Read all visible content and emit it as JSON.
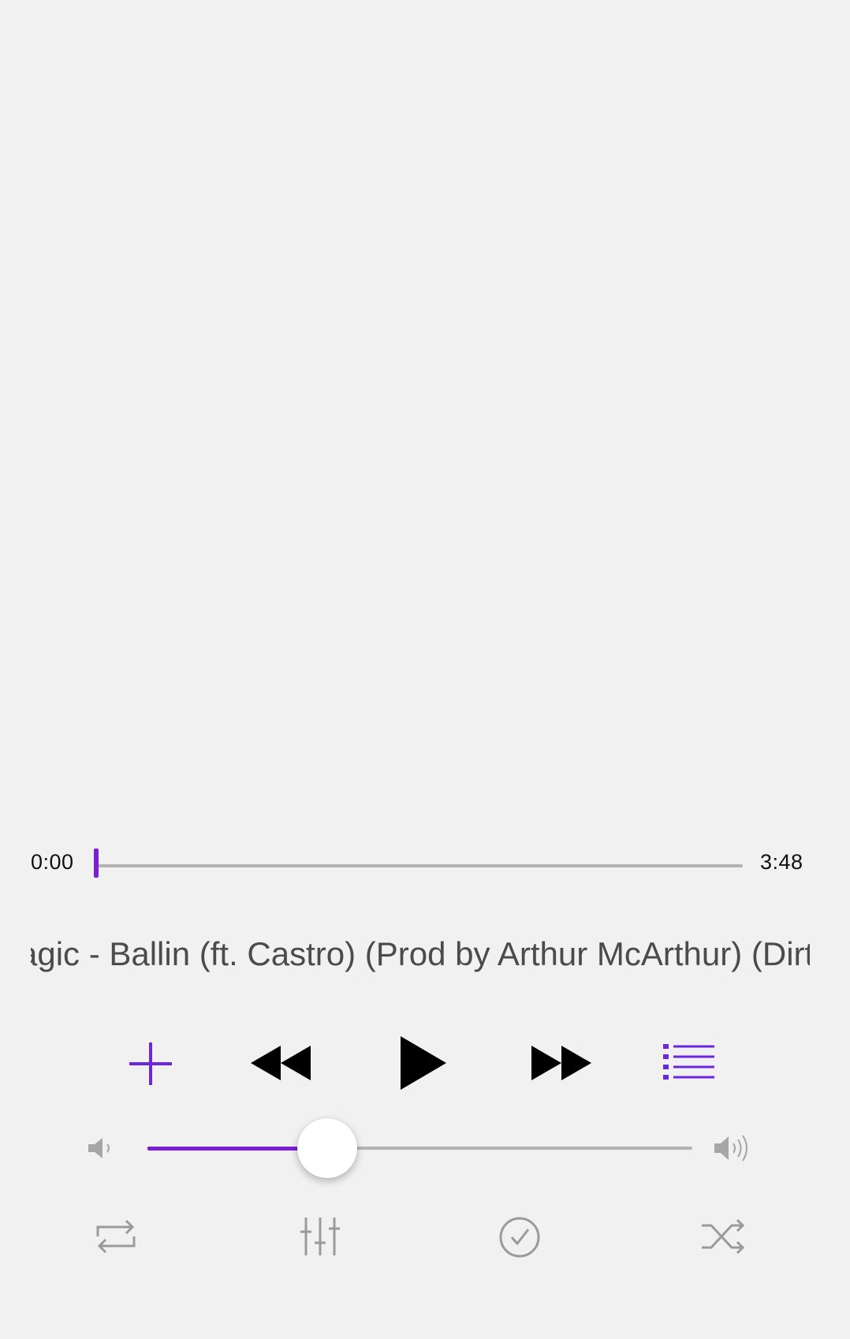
{
  "player": {
    "time_elapsed": "0:00",
    "time_total": "3:48",
    "progress_fraction": 0.0,
    "track_title": "Magic - Ballin (ft. Castro) (Prod by Arthur McArthur) (Dirty)",
    "volume_fraction": 0.33
  },
  "controls": {
    "add_icon": "plus-icon",
    "rewind_icon": "rewind-icon",
    "play_icon": "play-icon",
    "fast_forward_icon": "fast-forward-icon",
    "queue_icon": "list-icon"
  },
  "options": {
    "repeat_icon": "repeat-icon",
    "equalizer_icon": "equalizer-icon",
    "check_icon": "check-circle-icon",
    "shuffle_icon": "shuffle-icon"
  },
  "colors": {
    "accent": "#7a1fd6",
    "track": "#b3b3b3",
    "background": "#f1f1f1",
    "icon_gray": "#9a9a9a"
  }
}
